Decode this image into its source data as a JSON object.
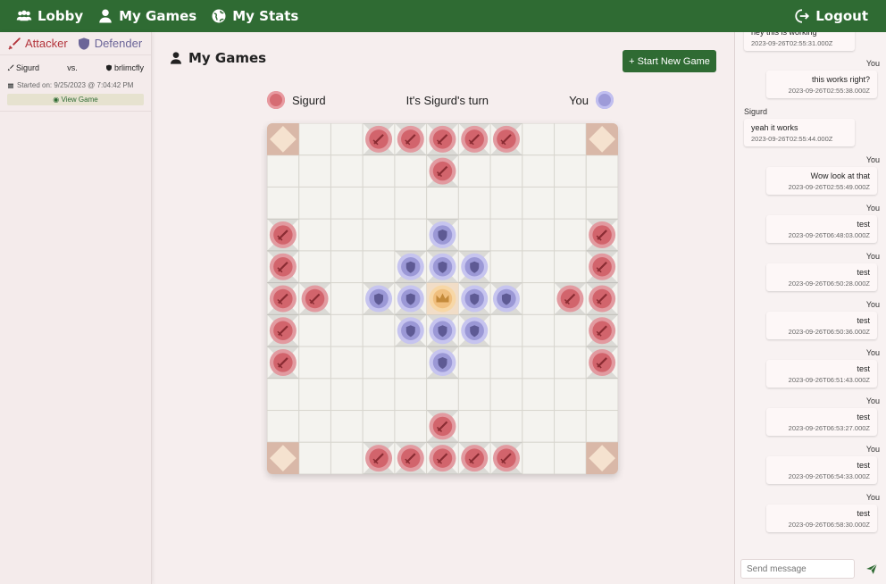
{
  "nav": {
    "lobby": "Lobby",
    "my_games": "My Games",
    "my_stats": "My Stats",
    "logout": "Logout"
  },
  "sidebar": {
    "attacker": "Attacker",
    "defender": "Defender",
    "game": {
      "attacker_name": "Sigurd",
      "vs": "vs.",
      "defender_name": "brlimcfly",
      "started": "Started on: 9/25/2023 @ 7:04:42 PM",
      "view": "View Game"
    }
  },
  "main": {
    "title": "My Games",
    "new_game": "+ Start New Game",
    "player_left": "Sigurd",
    "turn_text": "It's Sigurd's turn",
    "player_right": "You"
  },
  "board": {
    "size": 11,
    "corners": [
      [
        0,
        0
      ],
      [
        0,
        10
      ],
      [
        10,
        0
      ],
      [
        10,
        10
      ]
    ],
    "attackers": [
      [
        0,
        3
      ],
      [
        0,
        4
      ],
      [
        0,
        5
      ],
      [
        0,
        6
      ],
      [
        0,
        7
      ],
      [
        1,
        5
      ],
      [
        3,
        0
      ],
      [
        4,
        0
      ],
      [
        5,
        0
      ],
      [
        6,
        0
      ],
      [
        7,
        0
      ],
      [
        5,
        1
      ],
      [
        3,
        10
      ],
      [
        4,
        10
      ],
      [
        5,
        10
      ],
      [
        6,
        10
      ],
      [
        7,
        10
      ],
      [
        5,
        9
      ],
      [
        10,
        3
      ],
      [
        10,
        4
      ],
      [
        10,
        5
      ],
      [
        10,
        6
      ],
      [
        10,
        7
      ],
      [
        9,
        5
      ]
    ],
    "defenders": [
      [
        3,
        5
      ],
      [
        4,
        4
      ],
      [
        4,
        5
      ],
      [
        4,
        6
      ],
      [
        5,
        3
      ],
      [
        5,
        4
      ],
      [
        5,
        6
      ],
      [
        5,
        7
      ],
      [
        6,
        4
      ],
      [
        6,
        5
      ],
      [
        6,
        6
      ],
      [
        7,
        5
      ]
    ],
    "king": [
      5,
      5
    ]
  },
  "chat": {
    "messages": [
      {
        "sender": "",
        "text": "hey this is working",
        "time": "2023-09-26T02:55:31.000Z",
        "mine": false
      },
      {
        "sender": "You",
        "text": "this works right?",
        "time": "2023-09-26T02:55:38.000Z",
        "mine": true
      },
      {
        "sender": "Sigurd",
        "text": "yeah it works",
        "time": "2023-09-26T02:55:44.000Z",
        "mine": false
      },
      {
        "sender": "You",
        "text": "Wow look at that",
        "time": "2023-09-26T02:55:49.000Z",
        "mine": true
      },
      {
        "sender": "You",
        "text": "test",
        "time": "2023-09-26T06:48:03.000Z",
        "mine": true
      },
      {
        "sender": "You",
        "text": "test",
        "time": "2023-09-26T06:50:28.000Z",
        "mine": true
      },
      {
        "sender": "You",
        "text": "test",
        "time": "2023-09-26T06:50:36.000Z",
        "mine": true
      },
      {
        "sender": "You",
        "text": "test",
        "time": "2023-09-26T06:51:43.000Z",
        "mine": true
      },
      {
        "sender": "You",
        "text": "test",
        "time": "2023-09-26T06:53:27.000Z",
        "mine": true
      },
      {
        "sender": "You",
        "text": "test",
        "time": "2023-09-26T06:54:33.000Z",
        "mine": true
      },
      {
        "sender": "You",
        "text": "test",
        "time": "2023-09-26T06:58:30.000Z",
        "mine": true
      }
    ],
    "placeholder": "Send message"
  },
  "colors": {
    "nav_green": "#2f6b33",
    "attacker_red": "#d66c73",
    "defender_blue": "#9e9bd8",
    "king_gold": "#f3c98b"
  }
}
